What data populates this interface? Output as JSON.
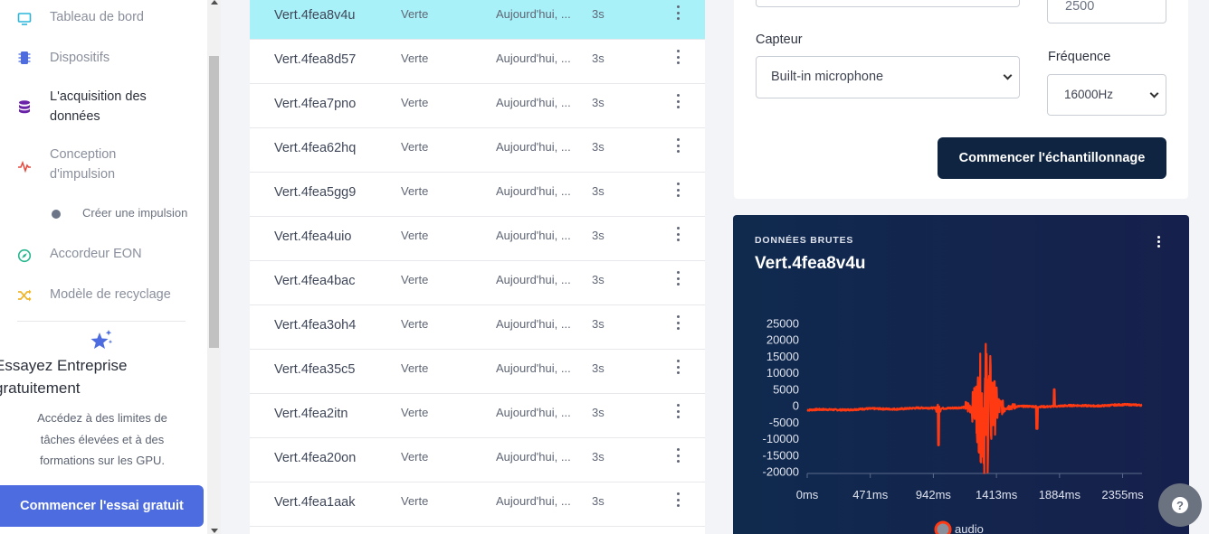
{
  "sidebar": {
    "items": [
      {
        "label": "Tableau de bord",
        "icon": "monitor-icon"
      },
      {
        "label": "Dispositifs",
        "icon": "chip-icon"
      },
      {
        "label": "L'acquisition des",
        "label2": "données",
        "icon": "database-icon"
      },
      {
        "label": "Conception",
        "label2": "d'impulsion",
        "icon": "pulse-icon"
      },
      {
        "label": "Accordeur EON",
        "icon": "compass-icon"
      },
      {
        "label": "Modèle de recyclage",
        "icon": "shuffle-icon"
      }
    ],
    "sub_item": "Créer une impulsion",
    "promo": {
      "title_line1": "Essayez Entreprise",
      "title_line2": "gratuitement",
      "text_line1": "Accédez à des limites de",
      "text_line2": "tâches élevées et à des",
      "text_line3": "formations sur les GPU.",
      "button": "Commencer l'essai gratuit"
    }
  },
  "samples": [
    {
      "name": "Vert.4fea8v4u",
      "label": "Verte",
      "added": "Aujourd'hui, ...",
      "length": "3s"
    },
    {
      "name": "Vert.4fea8d57",
      "label": "Verte",
      "added": "Aujourd'hui, ...",
      "length": "3s"
    },
    {
      "name": "Vert.4fea7pno",
      "label": "Verte",
      "added": "Aujourd'hui, ...",
      "length": "3s"
    },
    {
      "name": "Vert.4fea62hq",
      "label": "Verte",
      "added": "Aujourd'hui, ...",
      "length": "3s"
    },
    {
      "name": "Vert.4fea5gg9",
      "label": "Verte",
      "added": "Aujourd'hui, ...",
      "length": "3s"
    },
    {
      "name": "Vert.4fea4uio",
      "label": "Verte",
      "added": "Aujourd'hui, ...",
      "length": "3s"
    },
    {
      "name": "Vert.4fea4bac",
      "label": "Verte",
      "added": "Aujourd'hui, ...",
      "length": "3s"
    },
    {
      "name": "Vert.4fea3oh4",
      "label": "Verte",
      "added": "Aujourd'hui, ...",
      "length": "3s"
    },
    {
      "name": "Vert.4fea35c5",
      "label": "Verte",
      "added": "Aujourd'hui, ...",
      "length": "3s"
    },
    {
      "name": "Vert.4fea2itn",
      "label": "Verte",
      "added": "Aujourd'hui, ...",
      "length": "3s"
    },
    {
      "name": "Vert.4fea20on",
      "label": "Verte",
      "added": "Aujourd'hui, ...",
      "length": "3s"
    },
    {
      "name": "Vert.4fea1aak",
      "label": "Verte",
      "added": "Aujourd'hui, ...",
      "length": "3s"
    }
  ],
  "collect": {
    "length_value": "2500",
    "sensor_label": "Capteur",
    "sensor_value": "Built-in microphone",
    "frequency_label": "Fréquence",
    "frequency_value": "16000Hz",
    "start_button": "Commencer l'échantillonnage"
  },
  "raw_data": {
    "kicker": "DONNÉES BRUTES",
    "title": "Vert.4fea8v4u",
    "legend": "audio"
  },
  "chart_data": {
    "type": "line",
    "series": [
      {
        "name": "audio"
      }
    ],
    "y_ticks": [
      "25000",
      "20000",
      "15000",
      "10000",
      "5000",
      "0",
      "-5000",
      "-10000",
      "-15000",
      "-20000"
    ],
    "x_ticks": [
      "0ms",
      "471ms",
      "942ms",
      "1413ms",
      "1884ms",
      "2355ms"
    ],
    "ylim": [
      -20000,
      25000
    ],
    "xlim": [
      0,
      2500
    ],
    "line_color": "#ff3a12"
  },
  "help_icon": "question-icon"
}
